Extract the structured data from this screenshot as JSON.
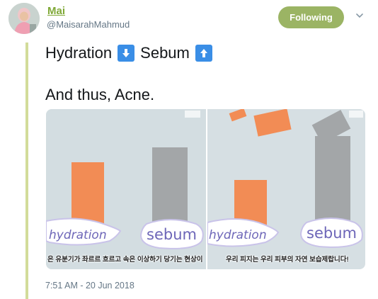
{
  "user": {
    "name": "Mai",
    "handle": "@MaisarahMahmud"
  },
  "actions": {
    "follow_label": "Following"
  },
  "tweet": {
    "line1_word1": "Hydration",
    "line1_icon1": "down-arrow-emoji",
    "line1_word2": "Sebum",
    "line1_icon2": "up-arrow-emoji",
    "line2": "And thus, Acne.",
    "timestamp": "7:51 AM - 20 Jun 2018"
  },
  "media": {
    "left": {
      "label_hydration": "hydration",
      "label_sebum": "sebum",
      "caption": "은 유분기가 좌르르 흐르고 속은 이상하기 당기는 현상이"
    },
    "right": {
      "label_hydration": "hydration",
      "label_sebum": "sebum",
      "caption": "우리 피지는 우리 피부의 자연 보습제랍니다!"
    }
  },
  "colors": {
    "accent": "#9bb464",
    "name": "#7fa836",
    "thread": "#d2dc9a",
    "emoji_box": "#3a8ee6",
    "orange_paper": "#f28c55",
    "grey_paper": "#a3a6a8"
  }
}
